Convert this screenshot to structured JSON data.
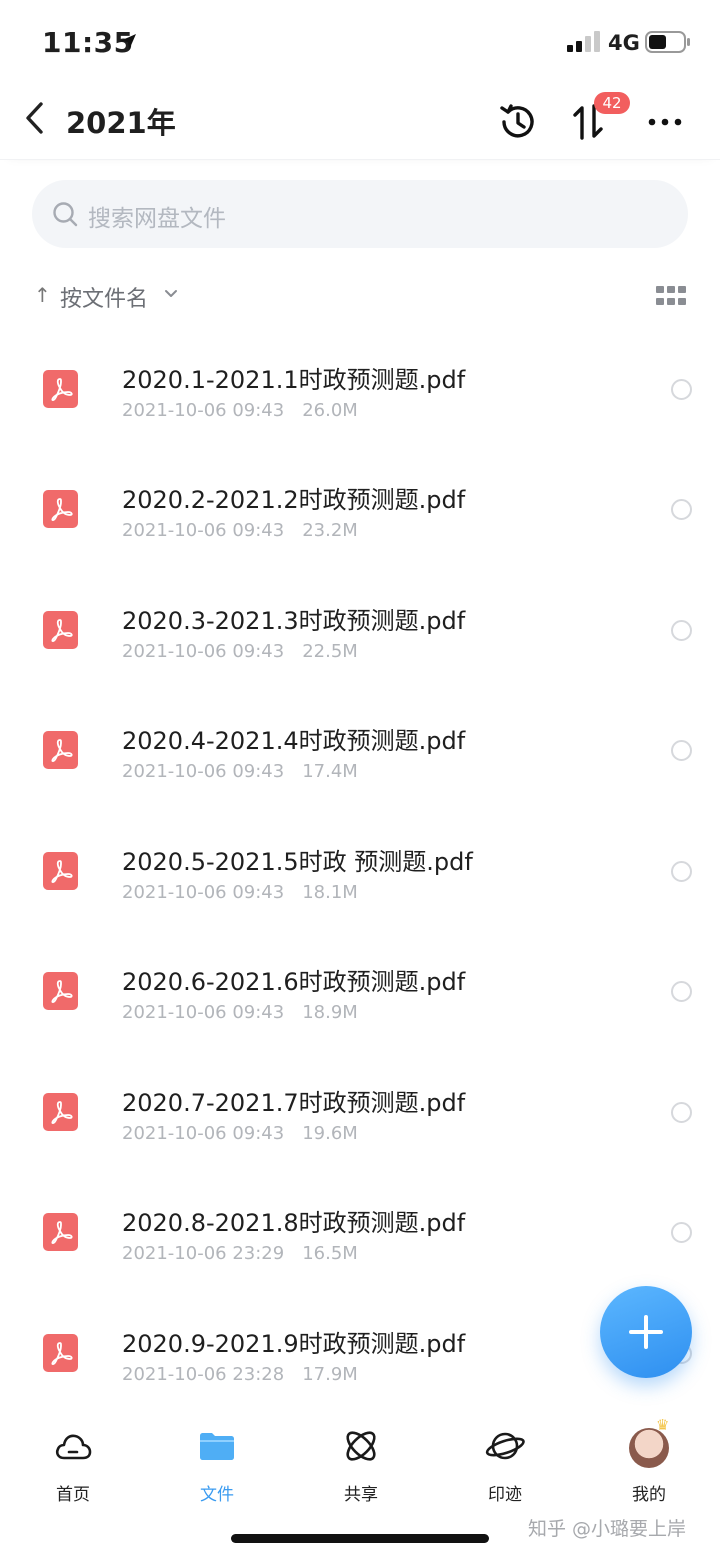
{
  "status_bar": {
    "time": "11:35",
    "network": "4G"
  },
  "header": {
    "title": "2021年",
    "transfer_badge": "42"
  },
  "search": {
    "placeholder": "搜索网盘文件"
  },
  "sort": {
    "label": "按文件名"
  },
  "colors": {
    "accent": "#3a9bf0",
    "pdf": "#f06a6a",
    "badge": "#f25e5e"
  },
  "files": [
    {
      "name": "2020.1-2021.1时政预测题.pdf",
      "date": "2021-10-06 09:43",
      "size": "26.0M"
    },
    {
      "name": "2020.2-2021.2时政预测题.pdf",
      "date": "2021-10-06 09:43",
      "size": "23.2M"
    },
    {
      "name": "2020.3-2021.3时政预测题.pdf",
      "date": "2021-10-06 09:43",
      "size": "22.5M"
    },
    {
      "name": "2020.4-2021.4时政预测题.pdf",
      "date": "2021-10-06 09:43",
      "size": "17.4M"
    },
    {
      "name": "2020.5-2021.5时政 预测题.pdf",
      "date": "2021-10-06 09:43",
      "size": "18.1M"
    },
    {
      "name": "2020.6-2021.6时政预测题.pdf",
      "date": "2021-10-06 09:43",
      "size": "18.9M"
    },
    {
      "name": "2020.7-2021.7时政预测题.pdf",
      "date": "2021-10-06 09:43",
      "size": "19.6M"
    },
    {
      "name": "2020.8-2021.8时政预测题.pdf",
      "date": "2021-10-06 23:29",
      "size": "16.5M"
    },
    {
      "name": "2020.9-2021.9时政预测题.pdf",
      "date": "2021-10-06 23:28",
      "size": "17.9M"
    }
  ],
  "tabs": [
    {
      "label": "首页",
      "icon": "cloud-icon"
    },
    {
      "label": "文件",
      "icon": "folder-icon",
      "active": true
    },
    {
      "label": "共享",
      "icon": "atom-icon"
    },
    {
      "label": "印迹",
      "icon": "planet-icon"
    },
    {
      "label": "我的",
      "icon": "avatar"
    }
  ],
  "watermark": "知乎 @小璐要上岸"
}
